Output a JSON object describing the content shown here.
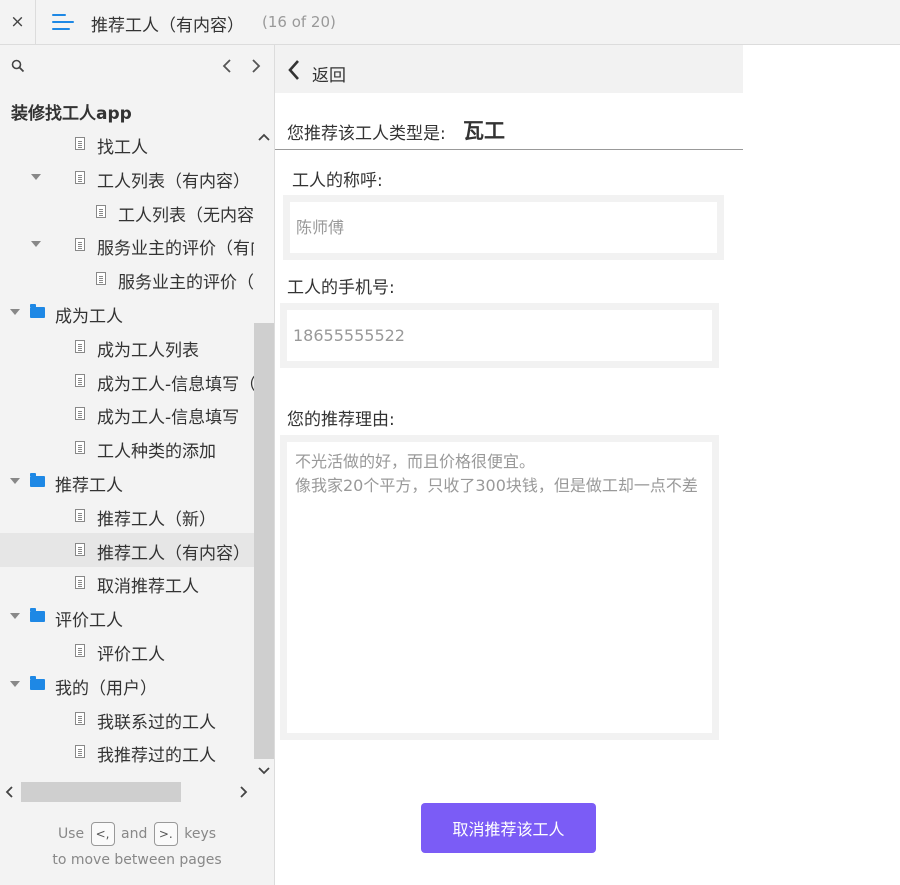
{
  "topbar": {
    "close_glyph": "×",
    "title": "推荐工人（有内容）",
    "page_count": "(16 of 20)"
  },
  "sidebar": {
    "project_title": "装修找工人app",
    "prev_glyph": "‹",
    "next_glyph": "›",
    "tree": [
      {
        "label": "找工人",
        "type": "page",
        "level": 2,
        "expanded": null,
        "selected": false
      },
      {
        "label": "工人列表（有内容）",
        "type": "page",
        "level": 2,
        "expanded": true,
        "selected": false
      },
      {
        "label": "工人列表（无内容）",
        "type": "page",
        "level": 3,
        "expanded": null,
        "selected": false
      },
      {
        "label": "服务业主的评价（有内容）",
        "type": "page",
        "level": 2,
        "expanded": true,
        "selected": false
      },
      {
        "label": "服务业主的评价（无内容）",
        "type": "page",
        "level": 3,
        "expanded": null,
        "selected": false
      },
      {
        "label": "成为工人",
        "type": "folder",
        "level": 1,
        "expanded": true,
        "selected": false
      },
      {
        "label": "成为工人列表",
        "type": "page",
        "level": 2,
        "expanded": null,
        "selected": false
      },
      {
        "label": "成为工人-信息填写（案例）",
        "type": "page",
        "level": 2,
        "expanded": null,
        "selected": false
      },
      {
        "label": "成为工人-信息填写",
        "type": "page",
        "level": 2,
        "expanded": null,
        "selected": false
      },
      {
        "label": "工人种类的添加",
        "type": "page",
        "level": 2,
        "expanded": null,
        "selected": false
      },
      {
        "label": "推荐工人",
        "type": "folder",
        "level": 1,
        "expanded": true,
        "selected": false
      },
      {
        "label": "推荐工人（新）",
        "type": "page",
        "level": 2,
        "expanded": null,
        "selected": false
      },
      {
        "label": "推荐工人（有内容）",
        "type": "page",
        "level": 2,
        "expanded": null,
        "selected": true
      },
      {
        "label": "取消推荐工人",
        "type": "page",
        "level": 2,
        "expanded": null,
        "selected": false
      },
      {
        "label": "评价工人",
        "type": "folder",
        "level": 1,
        "expanded": true,
        "selected": false
      },
      {
        "label": "评价工人",
        "type": "page",
        "level": 2,
        "expanded": null,
        "selected": false
      },
      {
        "label": "我的（用户）",
        "type": "folder",
        "level": 1,
        "expanded": true,
        "selected": false
      },
      {
        "label": "我联系过的工人",
        "type": "page",
        "level": 2,
        "expanded": null,
        "selected": false
      },
      {
        "label": "我推荐过的工人",
        "type": "page",
        "level": 2,
        "expanded": null,
        "selected": false
      }
    ],
    "hint": {
      "use": "Use",
      "key_prev": "<,",
      "and": "and",
      "key_next": ">.",
      "keys": "keys",
      "line2": "to move between pages"
    }
  },
  "content": {
    "back_label": "返回",
    "type_label": "您推荐该工人类型是:",
    "type_value": "瓦工",
    "name_label": "工人的称呼:",
    "name_placeholder": "陈师傅",
    "phone_label": "工人的手机号:",
    "phone_placeholder": "18655555522",
    "reason_label": "您的推荐理由:",
    "reason_placeholder": "不光活做的好，而且价格很便宜。\n像我家20个平方，只收了300块钱，但是做工却一点不差",
    "cancel_button": "取消推荐该工人"
  },
  "colors": {
    "accent": "#1e88e5",
    "button": "#7b5cf6",
    "sidebar_bg": "#f3f3f3",
    "selected_bg": "#e6e6e6"
  }
}
